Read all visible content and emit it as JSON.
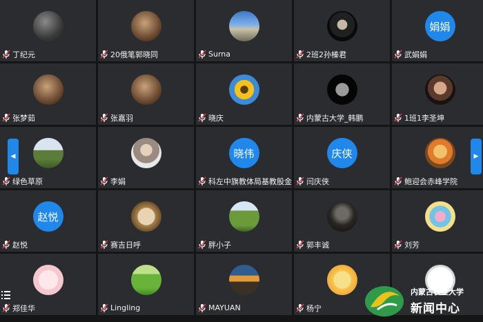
{
  "participants": [
    {
      "name": "丁纪元",
      "avatar_text": "",
      "avatar_kind": "photo"
    },
    {
      "name": "20俄笔郭晓同",
      "avatar_text": "",
      "avatar_kind": "photo warm"
    },
    {
      "name": "Surna",
      "avatar_text": "",
      "avatar_kind": "photo sky"
    },
    {
      "name": "2班2孙榛君",
      "avatar_text": "",
      "avatar_kind": "photo godfather"
    },
    {
      "name": "武娟娟",
      "avatar_text": "娟娟",
      "avatar_kind": "text"
    },
    {
      "name": "张梦茹",
      "avatar_text": "",
      "avatar_kind": "photo warm"
    },
    {
      "name": "张嘉羽",
      "avatar_text": "",
      "avatar_kind": "photo warm"
    },
    {
      "name": "晓庆",
      "avatar_text": "",
      "avatar_kind": "photo sun"
    },
    {
      "name": "内蒙古大学_韩鹏",
      "avatar_text": "",
      "avatar_kind": "photo moon"
    },
    {
      "name": "1班1李圣坤",
      "avatar_text": "",
      "avatar_kind": "photo oldman"
    },
    {
      "name": "绿色草原",
      "avatar_text": "",
      "avatar_kind": "photo land"
    },
    {
      "name": "李娟",
      "avatar_text": "",
      "avatar_kind": "photo woman"
    },
    {
      "name": "科左中旗教体局基教股金晓伟",
      "avatar_text": "晓伟",
      "avatar_kind": "text"
    },
    {
      "name": "闫庆侠",
      "avatar_text": "庆侠",
      "avatar_kind": "text"
    },
    {
      "name": "鲍迎会赤峰学院",
      "avatar_text": "",
      "avatar_kind": "photo cartoon"
    },
    {
      "name": "赵悦",
      "avatar_text": "赵悦",
      "avatar_kind": "text"
    },
    {
      "name": "赛吉日呼",
      "avatar_text": "",
      "avatar_kind": "photo paper"
    },
    {
      "name": "胖小子",
      "avatar_text": "",
      "avatar_kind": "photo field"
    },
    {
      "name": "郭丰诚",
      "avatar_text": "",
      "avatar_kind": "photo dark"
    },
    {
      "name": "刘芳",
      "avatar_text": "",
      "avatar_kind": "photo toy"
    },
    {
      "name": "郑佳华",
      "avatar_text": "",
      "avatar_kind": "photo pink"
    },
    {
      "name": "Lingling",
      "avatar_text": "",
      "avatar_kind": "photo grass"
    },
    {
      "name": "MAYUAN",
      "avatar_text": "",
      "avatar_kind": "photo sunset"
    },
    {
      "name": "杨宁",
      "avatar_text": "",
      "avatar_kind": "photo yellow"
    },
    {
      "name": "",
      "avatar_text": "",
      "avatar_kind": "photo sketch"
    }
  ],
  "navigation": {
    "prev_icon": "chevron-left-icon",
    "next_icon": "chevron-right-icon",
    "menu_icon": "list-icon"
  },
  "watermark": {
    "line1": "内蒙古农业大学",
    "line2": "新闻中心"
  },
  "colors": {
    "tile_bg": "#2b2c30",
    "accent": "#1f88ea",
    "mic_muted": "#e0424a",
    "text": "#f2f2f2"
  }
}
